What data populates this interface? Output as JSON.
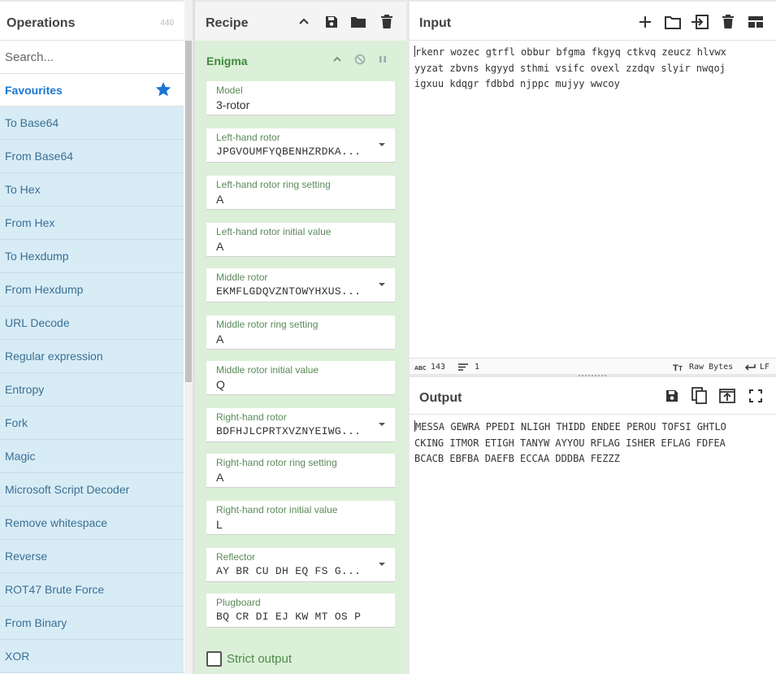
{
  "operations": {
    "title": "Operations",
    "count": "440",
    "search_placeholder": "Search...",
    "favourites_label": "Favourites",
    "items": [
      {
        "label": "To Base64"
      },
      {
        "label": "From Base64"
      },
      {
        "label": "To Hex"
      },
      {
        "label": "From Hex"
      },
      {
        "label": "To Hexdump"
      },
      {
        "label": "From Hexdump"
      },
      {
        "label": "URL Decode"
      },
      {
        "label": "Regular expression"
      },
      {
        "label": "Entropy"
      },
      {
        "label": "Fork"
      },
      {
        "label": "Magic"
      },
      {
        "label": "Microsoft Script Decoder"
      },
      {
        "label": "Remove whitespace"
      },
      {
        "label": "Reverse"
      },
      {
        "label": "ROT47 Brute Force"
      },
      {
        "label": "From Binary"
      },
      {
        "label": "XOR"
      }
    ]
  },
  "recipe": {
    "title": "Recipe",
    "operation": {
      "name": "Enigma",
      "fields": [
        {
          "label": "Model",
          "value": "3-rotor",
          "dropdown": false
        },
        {
          "label": "Left-hand rotor",
          "value": "JPGVOUMFYQBENHZRDKA...",
          "dropdown": true
        },
        {
          "label": "Left-hand rotor ring setting",
          "value": "A",
          "dropdown": false
        },
        {
          "label": "Left-hand rotor initial value",
          "value": "A",
          "dropdown": false
        },
        {
          "label": "Middle rotor",
          "value": "EKMFLGDQVZNTOWYHXUS...",
          "dropdown": true
        },
        {
          "label": "Middle rotor ring setting",
          "value": "A",
          "dropdown": false
        },
        {
          "label": "Middle rotor initial value",
          "value": "Q",
          "dropdown": false
        },
        {
          "label": "Right-hand rotor",
          "value": "BDFHJLCPRTXVZNYEIWG...",
          "dropdown": true
        },
        {
          "label": "Right-hand rotor ring setting",
          "value": "A",
          "dropdown": false
        },
        {
          "label": "Right-hand rotor initial value",
          "value": "L",
          "dropdown": false
        },
        {
          "label": "Reflector",
          "value": "AY BR CU DH EQ FS G...",
          "dropdown": true
        },
        {
          "label": "Plugboard",
          "value": "BQ CR DI EJ KW MT OS P...",
          "dropdown": false
        }
      ],
      "strict_output_label": "Strict output"
    }
  },
  "input": {
    "title": "Input",
    "lines": [
      "rkenr wozec gtrfl obbur bfgma fkgyq ctkvq zeucz hlvwx",
      "yyzat zbvns kgyyd sthmi vsifc ovexl zzdqv slyir nwqoj",
      "igxuu kdqgr fdbbd njppc mujyy wwcoy"
    ],
    "char_count": "143",
    "line_count": "1",
    "encoding_label": "Raw Bytes",
    "eol_label": "LF"
  },
  "output": {
    "title": "Output",
    "lines": [
      "MESSA GEWRA PPEDI NLIGH THIDD ENDEE PEROU TOFSI GHTLO",
      "CKING ITMOR ETIGH TANYW AYYOU RFLAG ISHER EFLAG FDFEA",
      "BCACB EBFBA DAEFB ECCAA DDDBA FEZZZ"
    ]
  },
  "colors": {
    "accent": "#1976d2",
    "op_item_bg": "#d8ecf6",
    "recipe_card_bg": "#dcefd8",
    "recipe_label": "#3f8a3c"
  }
}
